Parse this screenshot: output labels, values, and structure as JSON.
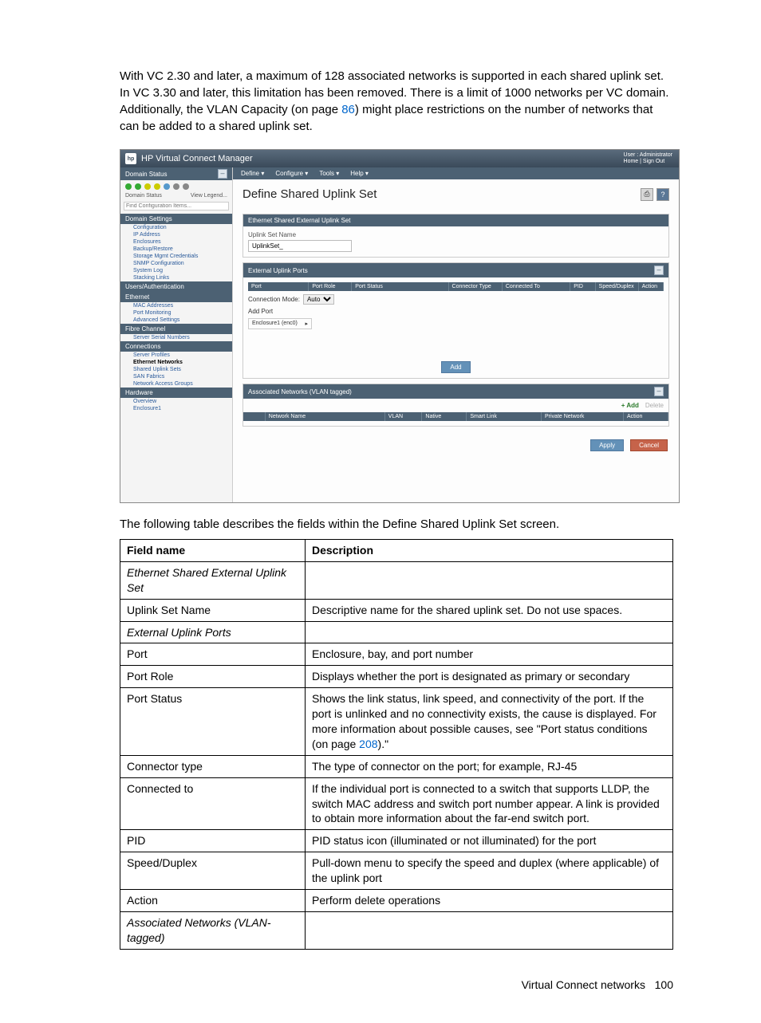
{
  "intro": {
    "part1": "With VC 2.30 and later, a maximum of 128 associated networks is supported in each shared uplink set. In VC 3.30 and later, this limitation has been removed. There is a limit of 1000 networks per VC domain. Additionally, the VLAN Capacity (on page ",
    "link": "86",
    "part2": ") might place restrictions on the number of networks that can be added to a shared uplink set."
  },
  "screenshot": {
    "title": "HP Virtual Connect Manager",
    "user_line1": "User : Administrator",
    "user_line2": "Home  |  Sign Out",
    "menus": [
      "Define ▾",
      "Configure ▾",
      "Tools ▾",
      "Help ▾"
    ],
    "sidebar": {
      "domain_status": "Domain Status",
      "status_label_left": "Domain Status",
      "status_label_right": "View Legend...",
      "search_placeholder": "Find Configuration Items...",
      "groups": [
        {
          "label": "Domain Settings",
          "items": [
            "Configuration",
            "IP Address",
            "Enclosures",
            "Backup/Restore",
            "Storage Mgmt Credentials",
            "SNMP Configuration",
            "System Log",
            "Stacking Links"
          ]
        },
        {
          "label": "Users/Authentication",
          "items": [],
          "icon": true
        },
        {
          "label": "Ethernet",
          "items": [
            "MAC Addresses",
            "Port Monitoring",
            "Advanced Settings"
          ],
          "icon": true
        },
        {
          "label": "Fibre Channel",
          "items": [
            "Server Serial Numbers"
          ],
          "icon": true
        },
        {
          "label": "Connections",
          "items": [
            "Server Profiles",
            "Ethernet Networks",
            "Shared Uplink Sets",
            "SAN Fabrics",
            "Network Access Groups"
          ],
          "highlight": "Ethernet Networks"
        },
        {
          "label": "Hardware",
          "items": [
            "Overview",
            "Enclosure1"
          ]
        }
      ]
    },
    "page_title": "Define Shared Uplink Set",
    "p1": {
      "head": "Ethernet Shared External Uplink Set",
      "field_label": "Uplink Set Name",
      "field_value": "UplinkSet_"
    },
    "p2": {
      "head": "External Uplink Ports",
      "cols": [
        "Port",
        "Port Role",
        "Port Status",
        "Connector Type",
        "Connected To",
        "PID",
        "Speed/Duplex",
        "Action"
      ],
      "conn_mode_label": "Connection Mode:",
      "conn_mode_value": "Auto",
      "add_port": "Add Port",
      "enclosure": "Enclosure1 (enc0)",
      "add_btn": "Add"
    },
    "p3": {
      "head": "Associated Networks (VLAN tagged)",
      "add": "+ Add",
      "delete": "Delete",
      "cols": [
        "",
        "Network Name",
        "VLAN",
        "Native",
        "Smart Link",
        "Private Network",
        "Action"
      ]
    },
    "apply": "Apply",
    "cancel": "Cancel"
  },
  "post_text": "The following table describes the fields within the Define Shared Uplink Set screen.",
  "table": {
    "head": [
      "Field name",
      "Description"
    ],
    "rows": [
      {
        "f": "Ethernet Shared External Uplink Set",
        "d": "",
        "it": true
      },
      {
        "f": "Uplink Set Name",
        "d": "Descriptive name for the shared uplink set. Do not use spaces."
      },
      {
        "f": "External Uplink Ports",
        "d": "",
        "it": true
      },
      {
        "f": "Port",
        "d": "Enclosure, bay, and port number"
      },
      {
        "f": "Port Role",
        "d": "Displays whether the port is designated as primary or secondary"
      },
      {
        "f": "Port Status",
        "d": "Shows the link status, link speed, and connectivity of the port. If the port is unlinked and no connectivity exists, the cause is displayed. For more information about possible causes, see \"Port status conditions (on page ",
        "link": "208",
        "tail": ").\""
      },
      {
        "f": "Connector type",
        "d": "The type of connector on the port; for example, RJ-45"
      },
      {
        "f": "Connected to",
        "d": "If the individual port is connected to a switch that supports LLDP, the switch MAC address and switch port number appear. A link is provided to obtain more information about the far-end switch port."
      },
      {
        "f": "PID",
        "d": "PID status icon (illuminated or not illuminated) for the port"
      },
      {
        "f": "Speed/Duplex",
        "d": "Pull-down menu to specify the speed and duplex (where applicable) of the uplink port"
      },
      {
        "f": "Action",
        "d": "Perform delete operations"
      },
      {
        "f": "Associated Networks (VLAN-tagged)",
        "d": "",
        "it": true
      }
    ]
  },
  "footer": {
    "label": "Virtual Connect networks",
    "page": "100"
  }
}
